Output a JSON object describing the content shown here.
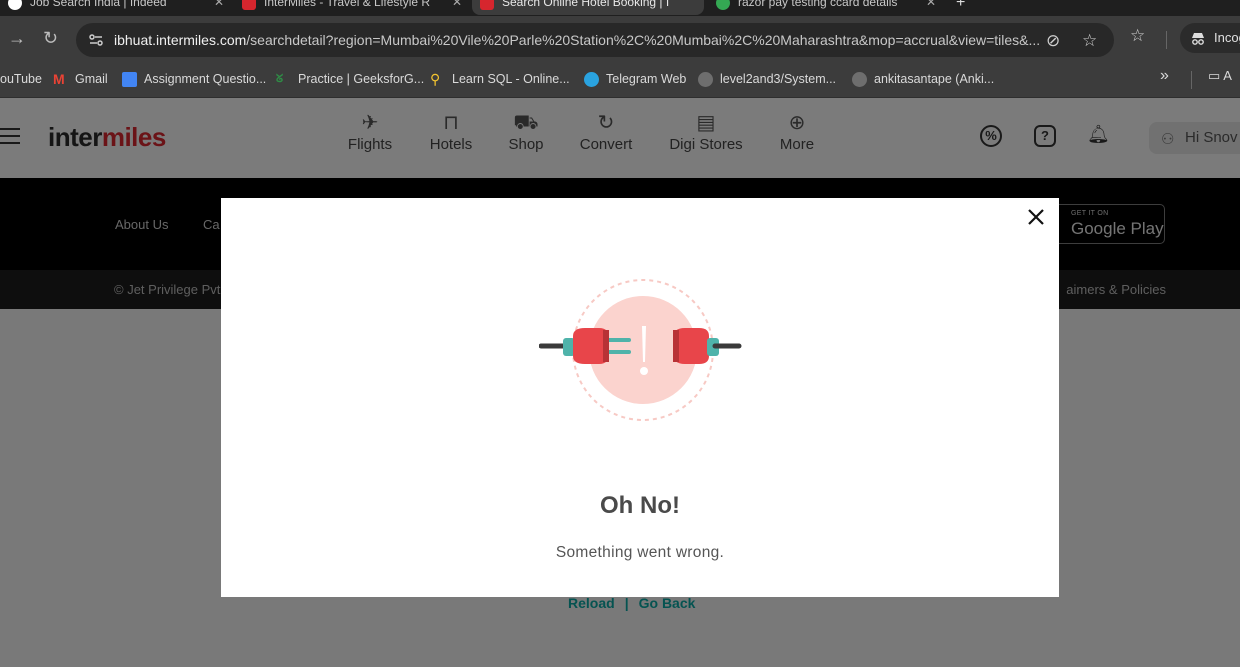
{
  "browser": {
    "tabs": [
      {
        "title": "Job Search India | Indeed",
        "favicon_color": "#ffffff"
      },
      {
        "title": "InterMiles - Travel & Lifestyle R",
        "favicon_color": "#d6262e"
      },
      {
        "title": "Search Online Hotel Booking | I",
        "favicon_color": "#d6262e"
      },
      {
        "title": "razor pay testing ccard details",
        "favicon_color": "#34a853"
      }
    ],
    "address": {
      "domain": "ibhuat.intermiles.com",
      "path": "/searchdetail?region=Mumbai%20Vile%20Parle%20Station%2C%20Mumbai%2C%20Maharashtra&mop=accrual&view=tiles&..."
    },
    "incognito_label": "Incog"
  },
  "bookmarks": [
    {
      "label": "ouTube",
      "favicon_color": ""
    },
    {
      "label": "Gmail",
      "favicon_color": "#ea4335"
    },
    {
      "label": "Assignment Questio...",
      "favicon_color": "#4285f4"
    },
    {
      "label": "Practice | GeeksforG...",
      "favicon_color": "#2f8d46"
    },
    {
      "label": "Learn SQL - Online...",
      "favicon_color": "#f4c430"
    },
    {
      "label": "Telegram Web",
      "favicon_color": "#2aa3e0"
    },
    {
      "label": "level2and3/System...",
      "favicon_color": "#6e6e6e"
    },
    {
      "label": "ankitasantape (Anki...",
      "favicon_color": "#6e6e6e"
    }
  ],
  "bookmarks_folder": "A",
  "site": {
    "logo_prefix": "inter",
    "logo_suffix": "miles",
    "nav": [
      "Flights",
      "Hotels",
      "Shop",
      "Convert",
      "Digi Stores",
      "More"
    ],
    "user_greeting": "Hi Snov",
    "footer_links": [
      "About Us",
      "Ca"
    ],
    "play_badge_small": "GET IT ON",
    "play_badge_large": "Google Play",
    "copyright": "© Jet Privilege Pvt",
    "disclaimers": "aimers & Policies",
    "reload": "Reload",
    "separator": "|",
    "go_back": "Go Back"
  },
  "modal": {
    "title": "Oh No!",
    "message": "Something went wrong."
  }
}
